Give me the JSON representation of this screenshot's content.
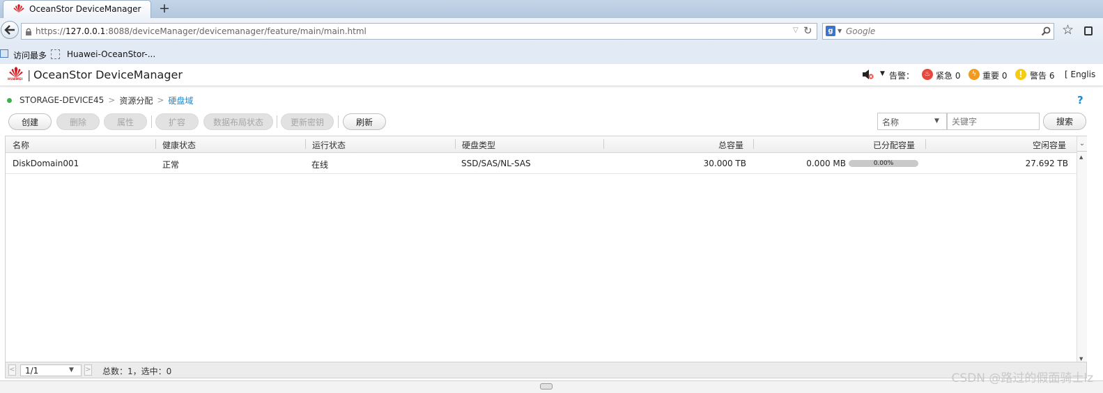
{
  "browser": {
    "tab_title": "OceanStor DeviceManager",
    "new_tab_label": "+",
    "url_prefix": "https://",
    "url_host": "127.0.0.1",
    "url_rest": ":8088/deviceManager/devicemanager/feature/main/main.html",
    "search_placeholder": "Google",
    "bookmarks": [
      {
        "label": "访问最多"
      },
      {
        "label": "Huawei-OceanStor-..."
      }
    ]
  },
  "app": {
    "logo_text": "HUAWEI",
    "separator": "|",
    "title": "OceanStor DeviceManager",
    "alarm_label": "告警：",
    "alarms": [
      {
        "label": "紧急 0",
        "color": "#e8473c",
        "icon": "urgent-icon"
      },
      {
        "label": "重要 0",
        "color": "#f29a1f",
        "icon": "major-icon"
      },
      {
        "label": "警告 6",
        "color": "#f5cc14",
        "icon": "warning-icon"
      }
    ],
    "language": "[ Englis"
  },
  "breadcrumb": [
    "STORAGE-DEVICE45",
    "资源分配",
    "硬盘域"
  ],
  "help": "?",
  "toolbar": {
    "create": "创建",
    "delete": "删除",
    "properties": "属性",
    "expand": "扩容",
    "data_layout": "数据布局状态",
    "update_key": "更新密钥",
    "refresh": "刷新",
    "filter_select": "名称",
    "keyword_placeholder": "关键字",
    "search": "搜索"
  },
  "table": {
    "columns": [
      "名称",
      "健康状态",
      "运行状态",
      "硬盘类型",
      "总容量",
      "已分配容量",
      "空闲容量"
    ],
    "rows": [
      {
        "name": "DiskDomain001",
        "health": "正常",
        "running": "在线",
        "disk_type": "SSD/SAS/NL-SAS",
        "total": "30.000 TB",
        "allocated": "0.000 MB",
        "allocated_pct": "0.00%",
        "allocated_fraction": 0,
        "free": "27.692 TB"
      }
    ]
  },
  "footer": {
    "page": "1/1",
    "summary": "总数：1，选中：0"
  },
  "watermark": "CSDN @路过的假面骑士lz",
  "colors": {
    "accent": "#1a8ad4",
    "status_dot": "#3bb34a",
    "huawei_red": "#d9151b"
  }
}
